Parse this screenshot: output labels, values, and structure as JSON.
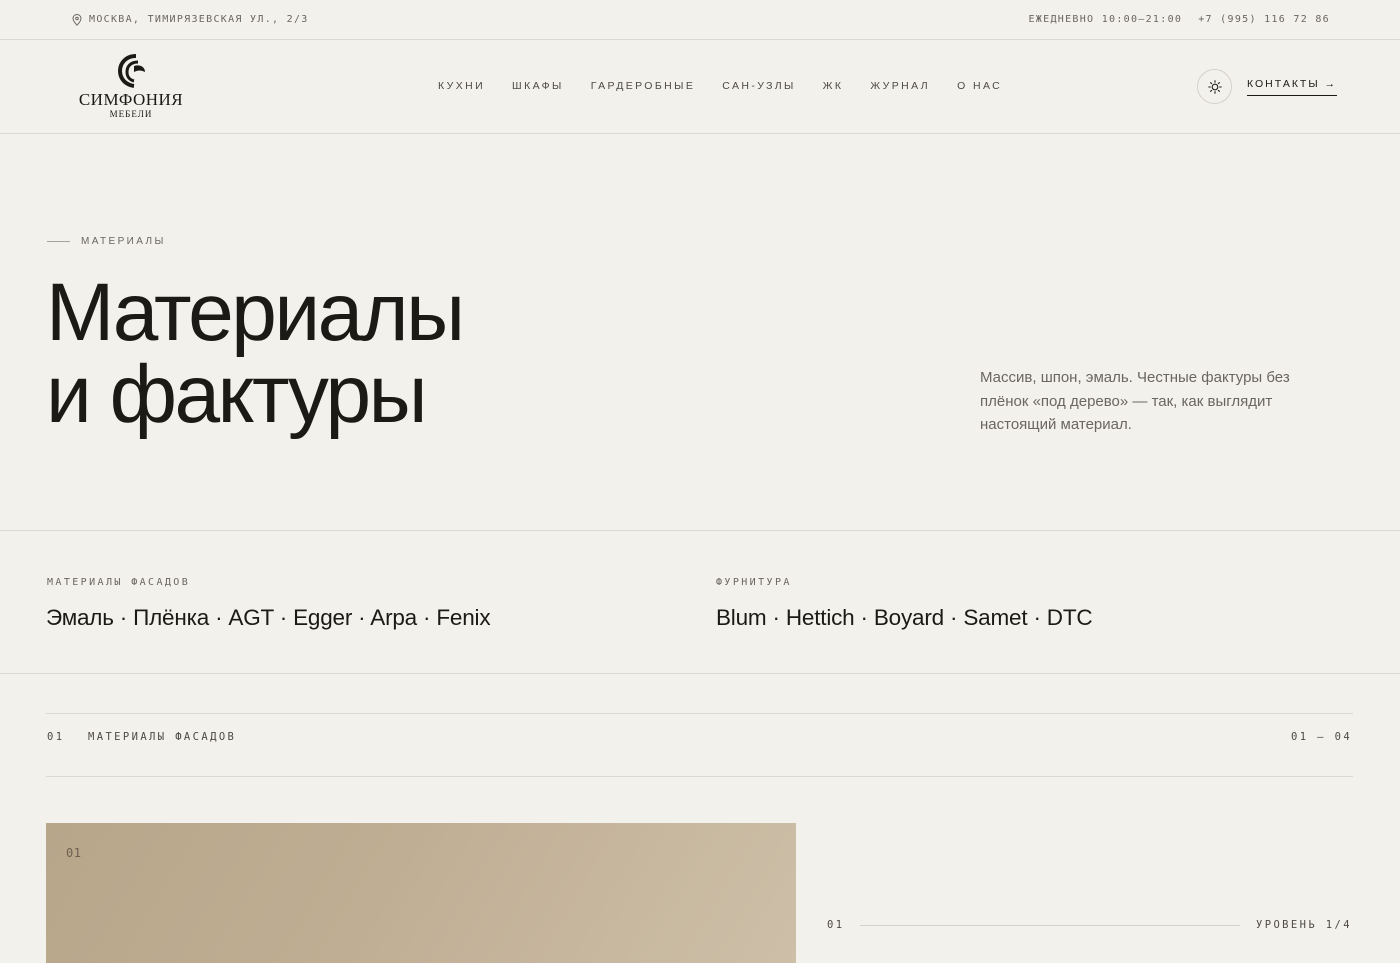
{
  "topbar": {
    "address": "МОСКВА, ТИМИРЯЗЕВСКАЯ УЛ., 2/3",
    "hours": "ЕЖЕДНЕВНО 10:00–21:00",
    "phone": "+7 (995) 116 72 86"
  },
  "header": {
    "logo_name": "СИМФОНИЯ",
    "logo_sub": "МЕБЕЛИ",
    "nav": [
      "КУХНИ",
      "ШКАФЫ",
      "ГАРДЕРОБНЫЕ",
      "САН-УЗЛЫ",
      "ЖК",
      "ЖУРНАЛ",
      "О НАС"
    ],
    "contacts_label": "КОНТАКТЫ →"
  },
  "hero": {
    "eyebrow": "МАТЕРИАЛЫ",
    "title_line1": "Материалы",
    "title_line2": "и фактуры",
    "description": "Массив, шпон, эмаль. Честные фактуры без плёнок «под дерево» — так, как выглядит настоящий материал."
  },
  "info": {
    "facades_label": "МАТЕРИАЛЫ ФАСАДОВ",
    "facades_value": "Эмаль · Плёнка · AGT · Egger · Arpa · Fenix",
    "hardware_label": "ФУРНИТУРА",
    "hardware_value": "Blum · Hettich · Boyard · Samet · DTC"
  },
  "section": {
    "num": "01",
    "title": "МАТЕРИАЛЫ ФАСАДОВ",
    "range": "01 — 04"
  },
  "item": {
    "swatch_num": "01",
    "level_num": "01",
    "level_text": "УРОВЕНЬ 1/4"
  },
  "colors": {
    "background": "#f3f1ec",
    "text": "#1c1a17",
    "muted": "#6b665e",
    "swatch": "#c0ae94"
  }
}
